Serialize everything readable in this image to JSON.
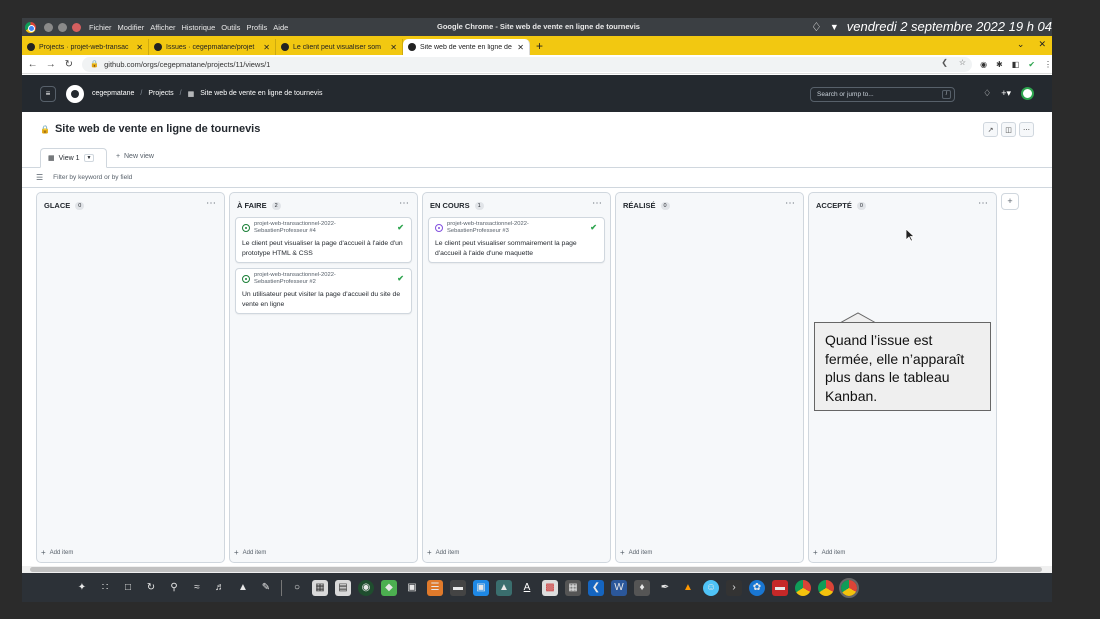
{
  "os_bar": {
    "menu": [
      "Fichier",
      "Modifier",
      "Afficher",
      "Historique",
      "Outils",
      "Profils",
      "Aide"
    ],
    "window_title": "Google Chrome - Site web de vente en ligne de tournevis",
    "clock": "vendredi 2 septembre 2022  19 h 04"
  },
  "tabs": [
    {
      "label": "Projects · projet-web-transac",
      "active": false
    },
    {
      "label": "Issues · cegepmatane/projet",
      "active": false
    },
    {
      "label": "Le client peut visualiser som",
      "active": false
    },
    {
      "label": "Site web de vente en ligne de",
      "active": true
    }
  ],
  "address": {
    "url": "github.com/orgs/cegepmatane/projects/11/views/1"
  },
  "github": {
    "org": "cegepmatane",
    "projects": "Projects",
    "project_name": "Site web de vente en ligne de tournevis",
    "search_placeholder": "Search or jump to...",
    "search_key": "/"
  },
  "project": {
    "title": "Site web de vente en ligne de tournevis",
    "view_tab": "View 1",
    "new_view": "New view",
    "filter_placeholder": "Filter by keyword or by field"
  },
  "columns": [
    {
      "title": "GLACE",
      "count": "0",
      "add_label": "Add item",
      "cards": []
    },
    {
      "title": "À FAIRE",
      "count": "2",
      "add_label": "Add item",
      "cards": [
        {
          "repo": "projet-web-transactionnel-2022-SebastienProfesseur #4",
          "text": "Le client peut visualiser la page d'accueil à l'aide d'un prototype HTML & CSS",
          "status_color": "#1a7f37"
        },
        {
          "repo": "projet-web-transactionnel-2022-SebastienProfesseur #2",
          "text": "Un utilisateur peut visiter la page d'accueil du site de vente en ligne",
          "status_color": "#1a7f37"
        }
      ]
    },
    {
      "title": "EN COURS",
      "count": "1",
      "add_label": "Add item",
      "cards": [
        {
          "repo": "projet-web-transactionnel-2022-SebastienProfesseur #3",
          "text": "Le client peut visualiser sommairement la page d'accueil à l'aide d'une maquette",
          "status_color": "#8250df"
        }
      ]
    },
    {
      "title": "RÉALISÉ",
      "count": "0",
      "add_label": "Add item",
      "cards": []
    },
    {
      "title": "ACCEPTÉ",
      "count": "0",
      "add_label": "Add item",
      "cards": []
    }
  ],
  "callout": {
    "text": "Quand l’issue est fermée, elle n’apparaît plus dans le tableau Kanban."
  },
  "colors": {
    "os_bar": "#3b3f43",
    "tab_bar": "#f2c811",
    "github_header": "#24292f",
    "success": "#2da44e"
  }
}
